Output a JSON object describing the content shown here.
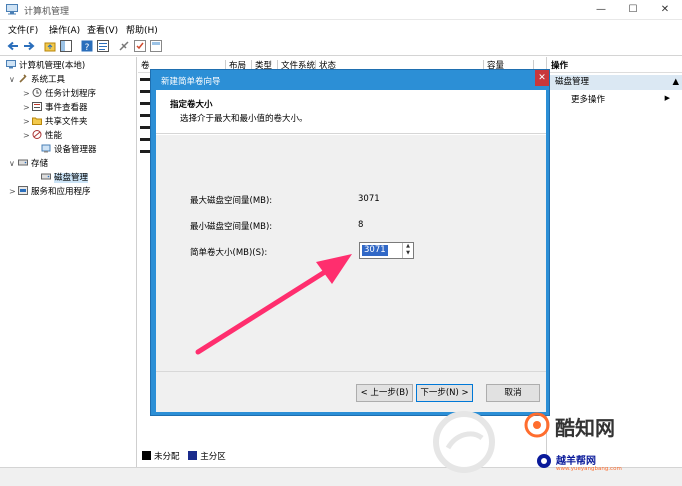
{
  "window": {
    "title": "计算机管理",
    "min_glyph": "—",
    "max_glyph": "☐",
    "close_glyph": "✕"
  },
  "menu": [
    {
      "label": "文件(F)"
    },
    {
      "label": "操作(A)"
    },
    {
      "label": "查看(V)"
    },
    {
      "label": "帮助(H)"
    }
  ],
  "tree": [
    {
      "label": "计算机管理(本地)",
      "icon": "computer-icon",
      "expander": ""
    },
    {
      "label": "系统工具",
      "icon": "tools-icon",
      "expander": "∨"
    },
    {
      "label": "任务计划程序",
      "icon": "clock-icon",
      "expander": ">"
    },
    {
      "label": "事件查看器",
      "icon": "event-viewer-icon",
      "expander": ">"
    },
    {
      "label": "共享文件夹",
      "icon": "folder-icon",
      "expander": ">"
    },
    {
      "label": "性能",
      "icon": "performance-icon",
      "expander": ">"
    },
    {
      "label": "设备管理器",
      "icon": "device-icon",
      "expander": ""
    },
    {
      "label": "存储",
      "icon": "storage-icon",
      "expander": "∨"
    },
    {
      "label": "磁盘管理",
      "icon": "disk-icon",
      "expander": "",
      "selected": true
    },
    {
      "label": "服务和应用程序",
      "icon": "services-icon",
      "expander": ">"
    }
  ],
  "columns": [
    {
      "label": "卷"
    },
    {
      "label": "布局"
    },
    {
      "label": "类型"
    },
    {
      "label": "文件系统"
    },
    {
      "label": "状态"
    },
    {
      "label": "容量"
    }
  ],
  "legend": [
    {
      "label": "未分配",
      "color": "#000000"
    },
    {
      "label": "主分区",
      "color": "#1a2b8c"
    }
  ],
  "actions": {
    "header": "操作",
    "section": "磁盘管理",
    "more": "更多操作",
    "more_arrow": "▶"
  },
  "wizard": {
    "title": "新建简单卷向导",
    "close": "✕",
    "heading": "指定卷大小",
    "subheading": "选择介于最大和最小值的卷大小。",
    "max_label": "最大磁盘空间量(MB):",
    "max_value": "3071",
    "min_label": "最小磁盘空间量(MB):",
    "min_value": "8",
    "size_label": "简单卷大小(MB)(S):",
    "size_value": "3071",
    "back_button": "< 上一步(B)",
    "next_button": "下一步(N) >",
    "cancel_button": "取消"
  },
  "watermark": {
    "brand": "酷知网",
    "site_name": "越羊帮网",
    "site_url": "www.yueyangbang.com"
  },
  "colors": {
    "accent": "#2c8fd6",
    "arrow": "#ff2e6e",
    "close_red": "#c8373b",
    "selection": "#3168c6"
  }
}
